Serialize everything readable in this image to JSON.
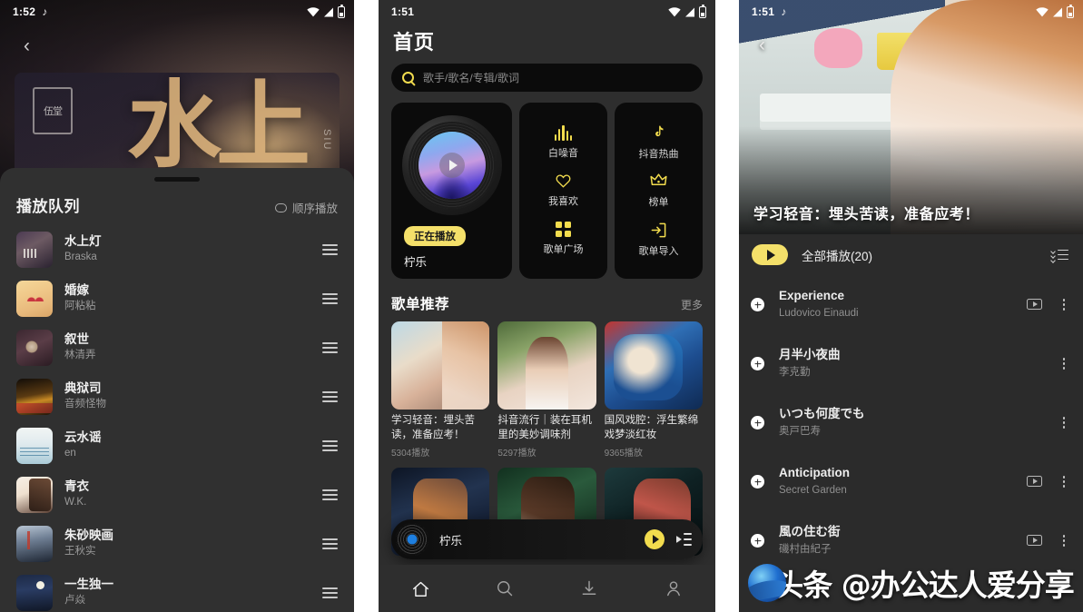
{
  "phone1": {
    "status": {
      "time": "1:52",
      "music_note": "♪"
    },
    "back_icon": "‹",
    "hero": {
      "cjk_big": "水上",
      "seal": "伍堂",
      "latin_side": "SIU"
    },
    "sheet": {
      "title": "播放队列",
      "mode_label": "顺序播放",
      "queue": [
        {
          "name": "水上灯",
          "artist": "Braska"
        },
        {
          "name": "婚嫁",
          "artist": "阿粘粘"
        },
        {
          "name": "叙世",
          "artist": "林清弄"
        },
        {
          "name": "典狱司",
          "artist": "音频怪物"
        },
        {
          "name": "云水谣",
          "artist": "en"
        },
        {
          "name": "青衣",
          "artist": "W.K."
        },
        {
          "name": "朱砂映画",
          "artist": "王秋实"
        },
        {
          "name": "一生独一",
          "artist": "卢焱"
        }
      ]
    }
  },
  "phone2": {
    "status": {
      "time": "1:51"
    },
    "page_title": "首页",
    "search": {
      "placeholder": "歌手/歌名/专辑/歌词",
      "icon": "search-icon"
    },
    "now_playing_tile": {
      "badge": "正在播放",
      "song": "柠乐"
    },
    "shortcuts_col1": [
      {
        "label": "白噪音",
        "icon": "waveform-icon"
      },
      {
        "label": "我喜欢",
        "icon": "heart-icon"
      },
      {
        "label": "歌单广场",
        "icon": "grid-icon"
      }
    ],
    "shortcuts_col2": [
      {
        "label": "抖音热曲",
        "icon": "tiktok-note-icon"
      },
      {
        "label": "榜单",
        "icon": "crown-icon"
      },
      {
        "label": "歌单导入",
        "icon": "import-arrow-icon"
      }
    ],
    "section": {
      "title": "歌单推荐",
      "more": "更多"
    },
    "cards_row1": [
      {
        "title": "学习轻音：埋头苦读，准备应考！",
        "plays": "5304播放"
      },
      {
        "title": "抖音流行｜装在耳机里的美妙调味剂",
        "plays": "5297播放"
      },
      {
        "title": "国风戏腔：浮生繁绵戏梦淡红妆",
        "plays": "9365播放"
      }
    ],
    "cards_row2": [
      {
        "title": ""
      },
      {
        "title": ""
      },
      {
        "title": ""
      }
    ],
    "miniplayer": {
      "song": "柠乐",
      "play_icon": "play-icon",
      "queue_icon": "playlist-icon"
    },
    "navbar": [
      {
        "name": "home",
        "icon": "home-icon",
        "active": true
      },
      {
        "name": "search",
        "icon": "search-icon",
        "active": false
      },
      {
        "name": "downloads",
        "icon": "download-icon",
        "active": false
      },
      {
        "name": "profile",
        "icon": "person-icon",
        "active": false
      }
    ]
  },
  "phone3": {
    "status": {
      "time": "1:51",
      "music_note": "♪"
    },
    "back_icon": "‹",
    "cover_title": "学习轻音：埋头苦读，准备应考！",
    "play_all": {
      "label": "全部播放(20)",
      "sort_icon": "sort-list-icon"
    },
    "tracks": [
      {
        "name": "Experience",
        "artist": "Ludovico Einaudi",
        "mv": true
      },
      {
        "name": "月半小夜曲",
        "artist": "李克勤",
        "mv": false
      },
      {
        "name": "いつも何度でも",
        "artist": "奥戸巴寿",
        "mv": false
      },
      {
        "name": "Anticipation",
        "artist": "Secret Garden",
        "mv": true
      },
      {
        "name": "風の住む街",
        "artist": "磯村由紀子",
        "mv": true
      }
    ],
    "watermark": {
      "text": "头条 @办公达人爱分享",
      "logo": "toutiao-globe-icon"
    }
  },
  "colors": {
    "accent_yellow": "#f2dc4e",
    "badge_yellow": "#f4e06a",
    "panel_bg": "#2e2e2e",
    "sheet_bg": "#303030",
    "tile_black": "#0b0b0b",
    "text_primary": "#efefef",
    "text_secondary": "#8f8f8f"
  }
}
